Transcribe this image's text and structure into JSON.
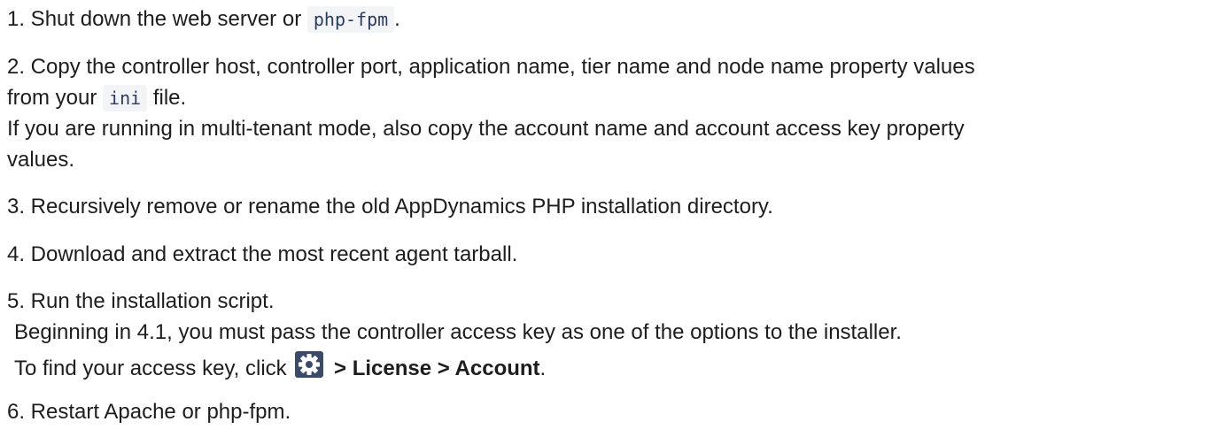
{
  "step1": {
    "text": "1. Shut down the web server or ",
    "code": "php-fpm",
    "tail": "."
  },
  "step2": {
    "line1": "2. Copy the controller host, controller port, application name, tier name and node name property values",
    "line2_pre": "from your ",
    "line2_code": "ini",
    "line2_post": " file.",
    "line3": "If you are running in multi-tenant mode, also copy the account name and account access key property",
    "line4": "values."
  },
  "step3": {
    "text": "3. Recursively remove or rename the old AppDynamics PHP installation directory."
  },
  "step4": {
    "text": "4. Download and extract the most recent agent tarball."
  },
  "step5": {
    "text": "5. Run the installation script.",
    "note1": "Beginning in 4.1, you must pass the controller access key as one of the options to the installer.",
    "note2_pre": "To find your access key, click ",
    "note2_path": " > License > Account",
    "note2_post": ".",
    "icon": "settings-gear-icon",
    "icon_color": "#3a4a6b"
  },
  "step6": {
    "text": "6. Restart Apache or php-fpm."
  }
}
